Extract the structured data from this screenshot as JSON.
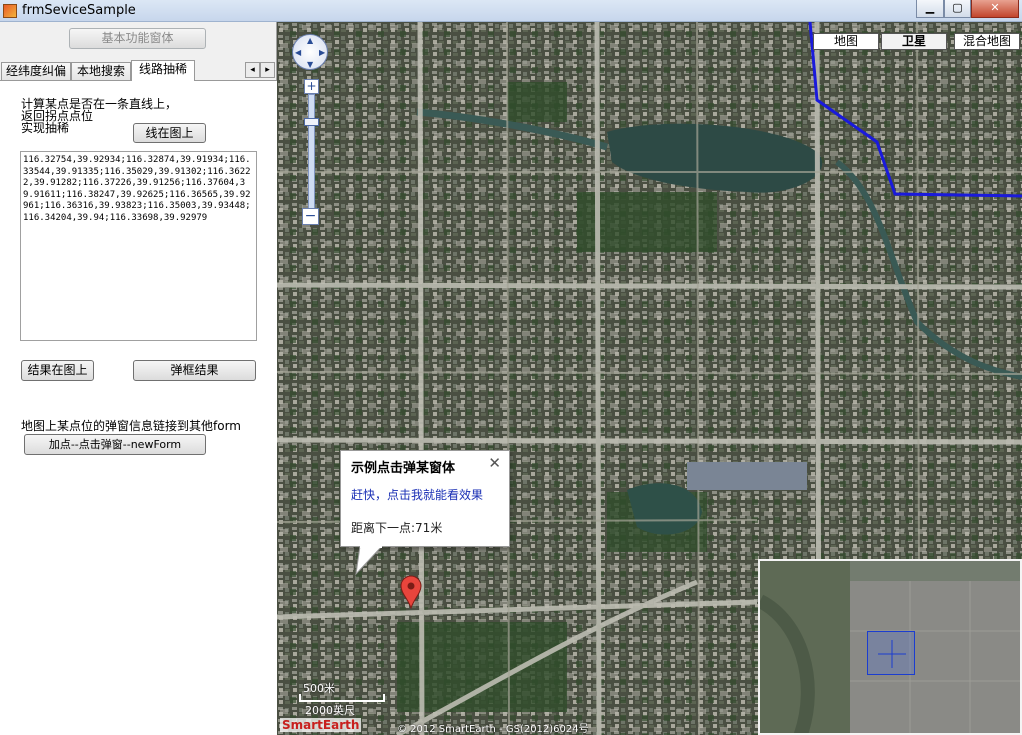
{
  "window": {
    "title": "frmSeviceSample",
    "min_glyph": "▁",
    "max_glyph": "▢",
    "close_glyph": "✕"
  },
  "left": {
    "basic_button": "基本功能窗体",
    "tabs": [
      "经纬度纠偏",
      "本地搜索",
      "线路抽稀"
    ],
    "active_tab": 2,
    "tab_scroll_left": "◂",
    "tab_scroll_right": "▸",
    "description": "计算某点是否在一条直线上，\n返回拐点点位\n实现抽稀",
    "line_on_map_button": "线在图上",
    "coordinates_text": "116.32754,39.92934;116.32874,39.91934;116.33544,39.91335;116.35029,39.91302;116.36222,39.91282;116.37226,39.91256;116.37604,39.91611;116.38247,39.92625;116.36565,39.92961;116.36316,39.93823;116.35003,39.93448;116.34204,39.94;116.33698,39.92979",
    "result_on_map_button": "结果在图上",
    "popup_result_button": "弹框结果",
    "link_description": "地图上某点位的弹窗信息链接到其他form",
    "add_point_button": "加点--点击弹窗--newForm"
  },
  "map": {
    "type_buttons": [
      "地图",
      "卫星",
      "混合地图"
    ],
    "selected_type": "卫星",
    "zoom_plus": "+",
    "zoom_minus": "−",
    "popup": {
      "title": "示例点击弹某窗体",
      "close": "✕",
      "link_text": "赶快，点击我就能看效果",
      "distance_text": "距离下一点:71米"
    },
    "scale_top": "500米",
    "scale_bottom": "2000英尺",
    "logo_text": "SmartEarth",
    "copyright": "© 2012 SmartEarth - GS(2012)6024号",
    "route_color": "#1a1adc",
    "pin_color": "#e8453c"
  }
}
